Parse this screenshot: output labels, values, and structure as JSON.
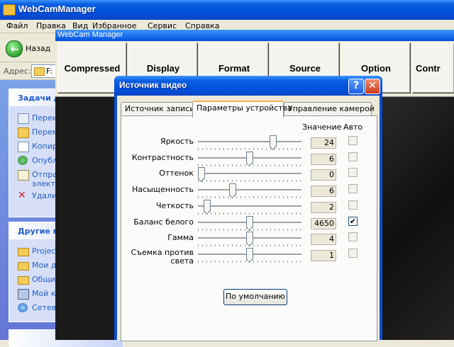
{
  "explorer": {
    "title": "WebCamManager",
    "menu": [
      "Файл",
      "Правка",
      "Вид",
      "Избранное",
      "Сервис",
      "Справка"
    ],
    "toolbar": {
      "back_label": "Назад"
    },
    "address": {
      "label": "Адрес:",
      "path": "F:"
    },
    "tasks_panel": {
      "title": "Задачи для файлов и п",
      "items": [
        {
          "label": "Переименовать файл",
          "icon": "rename-icon"
        },
        {
          "label": "Переместить файл",
          "icon": "move-icon"
        },
        {
          "label": "Копировать файл",
          "icon": "copy-icon"
        },
        {
          "label": "Опубликовать файл в",
          "icon": "publish-web-icon"
        },
        {
          "label": "Отправить этот файл",
          "label2": "электронной почте",
          "icon": "email-icon"
        },
        {
          "label": "Удалить файл",
          "icon": "delete-icon"
        }
      ]
    },
    "places_panel": {
      "title": "Другие места",
      "items": [
        {
          "label": "Projects",
          "icon": "folder-icon"
        },
        {
          "label": "Мои документы",
          "icon": "my-documents-icon"
        },
        {
          "label": "Общие документы",
          "icon": "shared-documents-icon"
        },
        {
          "label": "Мой компьютер",
          "icon": "my-computer-icon"
        },
        {
          "label": "Сетевое окружение",
          "icon": "network-icon"
        }
      ]
    }
  },
  "webcam_manager": {
    "title": "WebCam Manager",
    "buttons": [
      "Compressed",
      "Display",
      "Format",
      "Source",
      "Option",
      "Contr"
    ]
  },
  "dialog": {
    "title": "Источник видео",
    "help": "?",
    "close": "✕",
    "tabs": [
      "Источник записи",
      "Параметры устройства",
      "Управление камерой"
    ],
    "active_tab": 1,
    "headers": {
      "value": "Значение",
      "auto": "Авто"
    },
    "properties": [
      {
        "label": "Яркость",
        "value": "24",
        "level": 0.74,
        "auto": false
      },
      {
        "label": "Контрастность",
        "value": "6",
        "level": 0.5,
        "auto": false
      },
      {
        "label": "Оттенок",
        "value": "0",
        "level": 0.0,
        "auto": false
      },
      {
        "label": "Насыщенность",
        "value": "6",
        "level": 0.32,
        "auto": false
      },
      {
        "label": "Четкость",
        "value": "2",
        "level": 0.06,
        "auto": false
      },
      {
        "label": "Баланс белого",
        "value": "4650",
        "level": 0.5,
        "auto": true
      },
      {
        "label": "Гамма",
        "value": "4",
        "level": 0.5,
        "auto": false
      },
      {
        "label": "Съемка против",
        "label2": "света",
        "value": "1",
        "level": 0.5,
        "auto": false
      }
    ],
    "defaults_button": "По умолчанию"
  }
}
